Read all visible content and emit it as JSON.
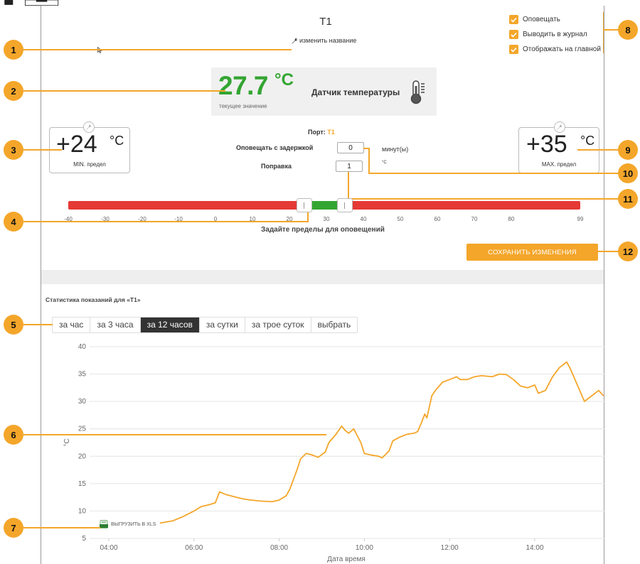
{
  "sensor": {
    "title": "T1",
    "rename_label": "изменить название",
    "current_value": "27.7",
    "current_unit": "°C",
    "current_label": "текущее значение",
    "type_name": "Датчик температуры"
  },
  "options": [
    {
      "label": "Оповещать",
      "checked": true
    },
    {
      "label": "Выводить в журнал",
      "checked": true
    },
    {
      "label": "Отображать на главной",
      "checked": true
    }
  ],
  "min_limit": {
    "value": "+24",
    "unit": "°C",
    "label": "MIN. предел"
  },
  "max_limit": {
    "value": "+35",
    "unit": "°C",
    "label": "MAX. предел"
  },
  "settings": {
    "port_label": "Порт:",
    "port_value": "T1",
    "delay_label": "Оповещать с задержкой",
    "delay_value": "0",
    "delay_unit": "минут(ы)",
    "correction_label": "Поправка",
    "correction_value": "1",
    "correction_unit": "°C"
  },
  "range_slider": {
    "ticks": [
      "-40",
      "-30",
      "-20",
      "-10",
      "0",
      "10",
      "20",
      "30",
      "40",
      "50",
      "60",
      "70",
      "80",
      "99"
    ],
    "low": 24,
    "high": 35,
    "caption": "Задайте пределы для оповещений",
    "colors": {
      "out_of_range": "#e53935",
      "in_range": "#33a532"
    }
  },
  "save_button": "СОХРАНИТЬ ИЗМЕНЕНИЯ",
  "stats": {
    "title": "Статистика показаний для «T1»",
    "tabs": [
      {
        "label": "за час",
        "active": false
      },
      {
        "label": "за 3 часа",
        "active": false
      },
      {
        "label": "за 12 часов",
        "active": true
      },
      {
        "label": "за сутки",
        "active": false
      },
      {
        "label": "за трое суток",
        "active": false
      },
      {
        "label": "выбрать",
        "active": false
      }
    ],
    "export_label": "ВЫГРУЗИТЬ В XLS"
  },
  "callouts": [
    "1",
    "2",
    "3",
    "4",
    "5",
    "6",
    "7",
    "8",
    "9",
    "10",
    "11",
    "12"
  ],
  "colors": {
    "accent": "#f4a62a",
    "value_green": "#33a532",
    "line": "#f4a62a"
  },
  "chart_data": {
    "type": "line",
    "xlabel": "Дата время",
    "ylabel": "°C",
    "ylim": [
      5,
      40
    ],
    "yticks": [
      "5",
      "10",
      "15",
      "20",
      "25",
      "30",
      "35",
      "40"
    ],
    "xticks": [
      "04:00",
      "06:00",
      "08:00",
      "10:00",
      "12:00",
      "14:00"
    ],
    "grid": true,
    "series": [
      {
        "points": [
          [
            "05:12",
            7.8
          ],
          [
            "05:30",
            8.2
          ],
          [
            "05:45",
            9.0
          ],
          [
            "06:00",
            10.0
          ],
          [
            "06:10",
            10.8
          ],
          [
            "06:20",
            11.1
          ],
          [
            "06:30",
            11.5
          ],
          [
            "06:36",
            13.5
          ],
          [
            "06:45",
            13.0
          ],
          [
            "07:00",
            12.5
          ],
          [
            "07:10",
            12.2
          ],
          [
            "07:20",
            12.0
          ],
          [
            "07:35",
            11.8
          ],
          [
            "07:50",
            11.7
          ],
          [
            "08:00",
            12.0
          ],
          [
            "08:10",
            12.8
          ],
          [
            "08:15",
            14.0
          ],
          [
            "08:25",
            17.5
          ],
          [
            "08:30",
            19.5
          ],
          [
            "08:38",
            20.5
          ],
          [
            "08:45",
            20.3
          ],
          [
            "08:55",
            19.8
          ],
          [
            "09:05",
            20.8
          ],
          [
            "09:10",
            22.5
          ],
          [
            "09:20",
            24.0
          ],
          [
            "09:28",
            25.5
          ],
          [
            "09:33",
            24.7
          ],
          [
            "09:38",
            24.2
          ],
          [
            "09:45",
            25.0
          ],
          [
            "09:55",
            22.5
          ],
          [
            "10:00",
            20.5
          ],
          [
            "10:10",
            20.2
          ],
          [
            "10:20",
            20.0
          ],
          [
            "10:25",
            19.7
          ],
          [
            "10:35",
            21.0
          ],
          [
            "10:40",
            22.8
          ],
          [
            "10:50",
            23.5
          ],
          [
            "11:00",
            24.0
          ],
          [
            "11:10",
            24.2
          ],
          [
            "11:15",
            24.5
          ],
          [
            "11:20",
            26.0
          ],
          [
            "11:25",
            27.7
          ],
          [
            "11:28",
            27.0
          ],
          [
            "11:35",
            31.0
          ],
          [
            "11:40",
            32.0
          ],
          [
            "11:50",
            33.5
          ],
          [
            "12:00",
            34.0
          ],
          [
            "12:10",
            34.5
          ],
          [
            "12:15",
            34.0
          ],
          [
            "12:25",
            34.0
          ],
          [
            "12:35",
            34.5
          ],
          [
            "12:45",
            34.7
          ],
          [
            "13:00",
            34.5
          ],
          [
            "13:10",
            35.0
          ],
          [
            "13:20",
            34.9
          ],
          [
            "13:30",
            34.0
          ],
          [
            "13:40",
            32.8
          ],
          [
            "13:50",
            32.5
          ],
          [
            "14:00",
            33.0
          ],
          [
            "14:05",
            31.5
          ],
          [
            "14:15",
            32.0
          ],
          [
            "14:25",
            34.5
          ],
          [
            "14:35",
            36.2
          ],
          [
            "14:45",
            37.2
          ],
          [
            "14:50",
            36.0
          ],
          [
            "15:00",
            33.0
          ],
          [
            "15:10",
            30.0
          ],
          [
            "15:20",
            31.0
          ],
          [
            "15:30",
            32.0
          ],
          [
            "15:37",
            31.0
          ]
        ]
      }
    ]
  }
}
